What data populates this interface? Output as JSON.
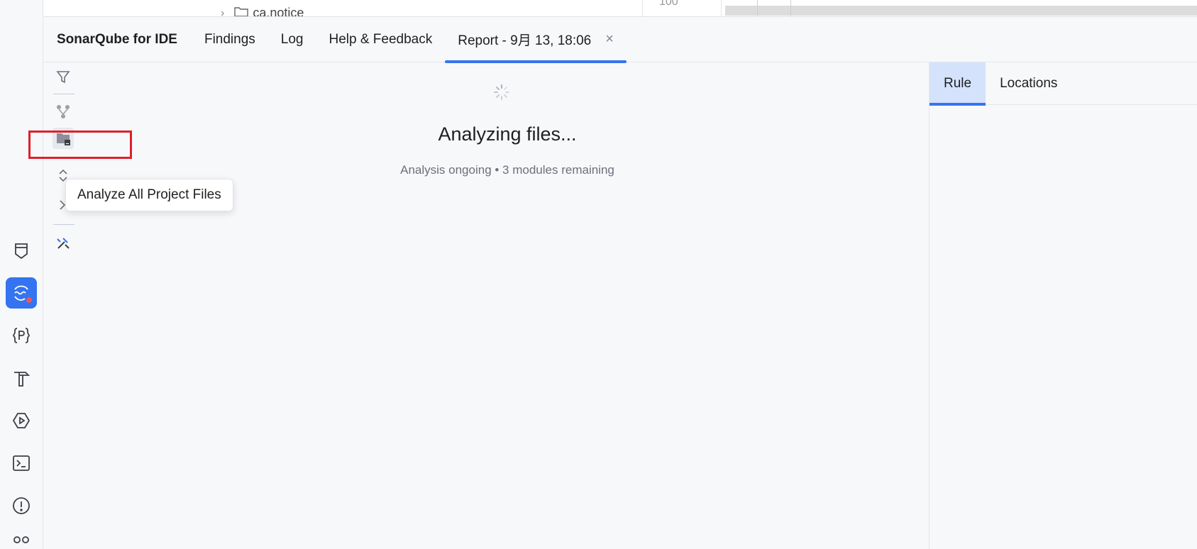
{
  "editor_peek": {
    "folder_name": "ca.notice",
    "line_number": "100"
  },
  "tool_window": {
    "title": "SonarQube for IDE",
    "tabs": [
      {
        "label": "Findings"
      },
      {
        "label": "Log"
      },
      {
        "label": "Help & Feedback"
      },
      {
        "label": "Report - 9月 13, 18:06",
        "selected": true,
        "closable": true
      }
    ],
    "close_glyph": "×"
  },
  "toolbar": {
    "icons": [
      "filter-icon",
      "branch-icon",
      "analyze-project-folder-icon",
      "expand-all-icon",
      "collapse-all-icon",
      "tools-icon"
    ],
    "tooltip": "Analyze All Project Files"
  },
  "analysis": {
    "title": "Analyzing files...",
    "status": "Analysis ongoing • 3 modules remaining"
  },
  "details": {
    "tabs": [
      {
        "label": "Rule",
        "selected": true
      },
      {
        "label": "Locations"
      }
    ]
  },
  "left_strip": {
    "icons": [
      "bookmark-icon",
      "sonarqube-icon",
      "json-p-icon",
      "build-hammer-icon",
      "run-services-icon",
      "terminal-icon",
      "problems-icon",
      "git-icon"
    ],
    "active": "sonarqube-icon"
  },
  "colors": {
    "accent": "#3574f0",
    "highlight": "#e0202a",
    "background": "#f7f8fa"
  }
}
